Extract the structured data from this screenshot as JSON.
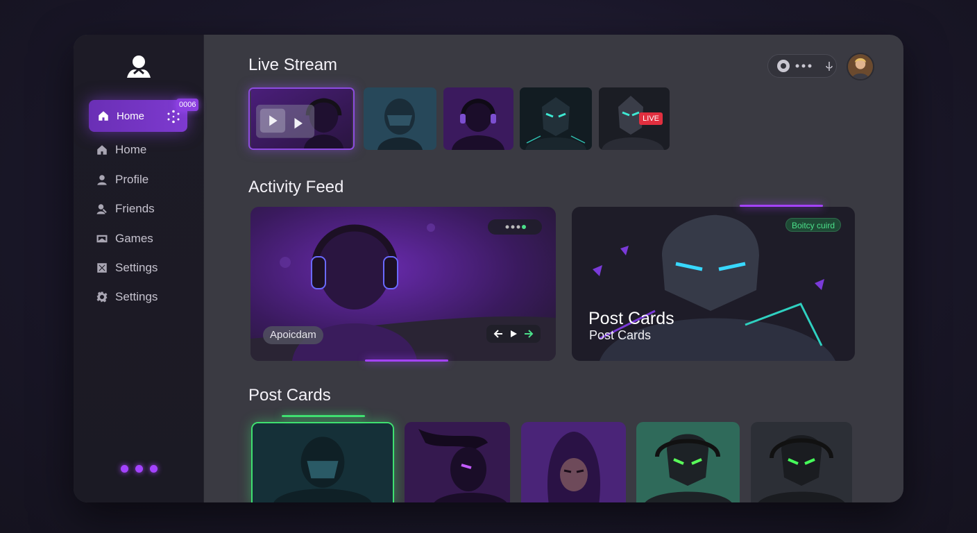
{
  "sidebar": {
    "active": {
      "label": "Home",
      "badge": "0006"
    },
    "items": [
      {
        "label": "Home",
        "icon": "home-icon"
      },
      {
        "label": "Profile",
        "icon": "profile-icon"
      },
      {
        "label": "Friends",
        "icon": "friends-icon"
      },
      {
        "label": "Games",
        "icon": "games-icon"
      },
      {
        "label": "Settings",
        "icon": "close-box-icon"
      },
      {
        "label": "Settings",
        "icon": "gear-icon"
      }
    ]
  },
  "sections": {
    "live": "Live Stream",
    "activity": "Activity Feed",
    "posts": "Post Cards"
  },
  "live_badge": "LIVE",
  "activity": {
    "left_chip": "Apoicdam",
    "right_chip": "Boitcy cuird",
    "right_title": "Post Cards",
    "right_subtitle": "Post Cards"
  },
  "colors": {
    "accent": "#8b3fe0",
    "live": "#e12f3f",
    "online": "#4be08a"
  }
}
